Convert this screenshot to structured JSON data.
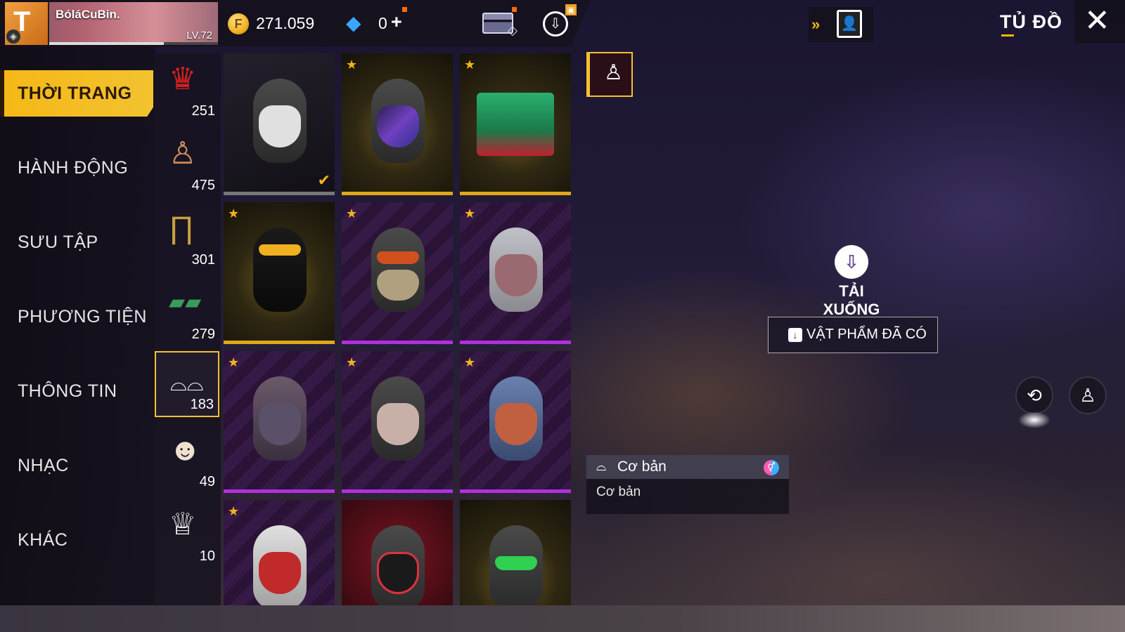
{
  "header": {
    "player_name": "BóláCuBin.",
    "player_level": "LV.72",
    "xp_fraction": 0.68,
    "gold_amount": "271.059",
    "diamond_amount": "0",
    "diamond_plus": "+",
    "page_title": "TỦ ĐỒ"
  },
  "menu": {
    "items": [
      {
        "label": "THỜI TRANG",
        "active": true
      },
      {
        "label": "HÀNH ĐỘNG",
        "active": false
      },
      {
        "label": "SƯU TẬP",
        "active": false
      },
      {
        "label": "PHƯƠNG TIỆN",
        "active": false
      },
      {
        "label": "THÔNG TIN",
        "active": false
      },
      {
        "label": "NHẠC",
        "active": false
      },
      {
        "label": "KHÁC",
        "active": false
      }
    ]
  },
  "categories": [
    {
      "icon": "hair-icon",
      "count": "251"
    },
    {
      "icon": "top-icon",
      "count": "475"
    },
    {
      "icon": "pants-icon",
      "count": "301"
    },
    {
      "icon": "shoes-icon",
      "count": "279"
    },
    {
      "icon": "glasses-icon",
      "count": "183",
      "selected": true
    },
    {
      "icon": "face-paint-icon",
      "count": "49"
    },
    {
      "icon": "outfit-icon",
      "count": "10"
    }
  ],
  "grid_items": [
    {
      "rarity": "gray",
      "star": false,
      "equipped": true
    },
    {
      "rarity": "gold",
      "star": true
    },
    {
      "rarity": "gold",
      "star": true
    },
    {
      "rarity": "gold",
      "star": true
    },
    {
      "rarity": "purple",
      "star": true
    },
    {
      "rarity": "purple",
      "star": true
    },
    {
      "rarity": "purple",
      "star": true
    },
    {
      "rarity": "purple",
      "star": true
    },
    {
      "rarity": "purple",
      "star": true
    },
    {
      "rarity": "purple",
      "star": true
    },
    {
      "rarity": "red",
      "star": false
    },
    {
      "rarity": "gold",
      "star": false
    }
  ],
  "preview": {
    "download_label": "TẢI XUỐNG",
    "owned_label": "VẬT PHẨM ĐÃ CÓ"
  },
  "item_info": {
    "name": "Cơ bản",
    "description": "Cơ bản"
  },
  "colors": {
    "accent": "#f2c230",
    "gold_rarity": "#e0a818",
    "purple_rarity": "#b030e0"
  }
}
